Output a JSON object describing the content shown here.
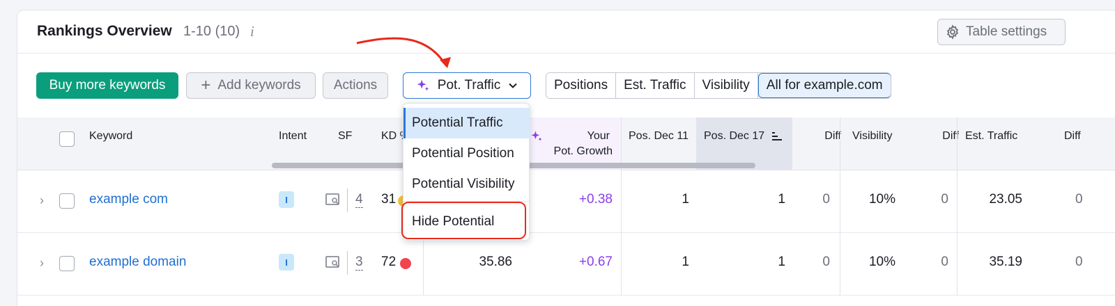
{
  "header": {
    "title": "Rankings Overview",
    "range": "1-10 (10)",
    "info_icon": "i",
    "table_settings_label": "Table settings"
  },
  "toolbar": {
    "buy_label": "Buy more keywords",
    "add_label": "Add keywords",
    "add_plus": "+",
    "actions_label": "Actions",
    "pot_label": "Pot. Traffic"
  },
  "segments": [
    "Positions",
    "Est. Traffic",
    "Visibility",
    "All for example.com"
  ],
  "columns": {
    "keyword": "Keyword",
    "intent": "Intent",
    "sf": "SF",
    "kd": "KD %",
    "your_pot_growth_line1": "Your",
    "your_pot_growth_line2": "Pot. Growth",
    "pos_dec11": "Pos. Dec 11",
    "pos_dec17": "Pos. Dec 17",
    "diff1": "Diff",
    "visibility": "Visibility",
    "diff2": "Diff",
    "est_traffic": "Est. Traffic",
    "diff3": "Diff"
  },
  "rows": [
    {
      "keyword": "example com",
      "intent": "I",
      "sf": "4",
      "kd": "31",
      "kd_color": "#f6c23e",
      "potential": "",
      "growth": "+0.38",
      "pos_dec11": "1",
      "pos_dec17": "1",
      "diff1": "0",
      "visibility": "10%",
      "diff2": "0",
      "est_traffic": "23.05",
      "diff3": "0"
    },
    {
      "keyword": "example domain",
      "intent": "I",
      "sf": "3",
      "kd": "72",
      "kd_color": "#f0454f",
      "potential": "35.86",
      "growth": "+0.67",
      "pos_dec11": "1",
      "pos_dec17": "1",
      "diff1": "0",
      "visibility": "10%",
      "diff2": "0",
      "est_traffic": "35.19",
      "diff3": "0"
    }
  ],
  "dropdown": {
    "items": [
      "Potential Traffic",
      "Potential Position",
      "Potential Visibility",
      "Hide Potential"
    ],
    "selected": "Potential Traffic"
  },
  "colors": {
    "brand_green": "#0b9e7c",
    "accent_blue": "#2b77d8",
    "growth_purple": "#8b3ee8",
    "annotation_red": "#e8291c"
  },
  "icons": [
    "gear-icon",
    "plus-icon",
    "sparkle-icon",
    "chevron-down-icon",
    "sort-icon",
    "chevron-right-icon",
    "serp-icon"
  ]
}
